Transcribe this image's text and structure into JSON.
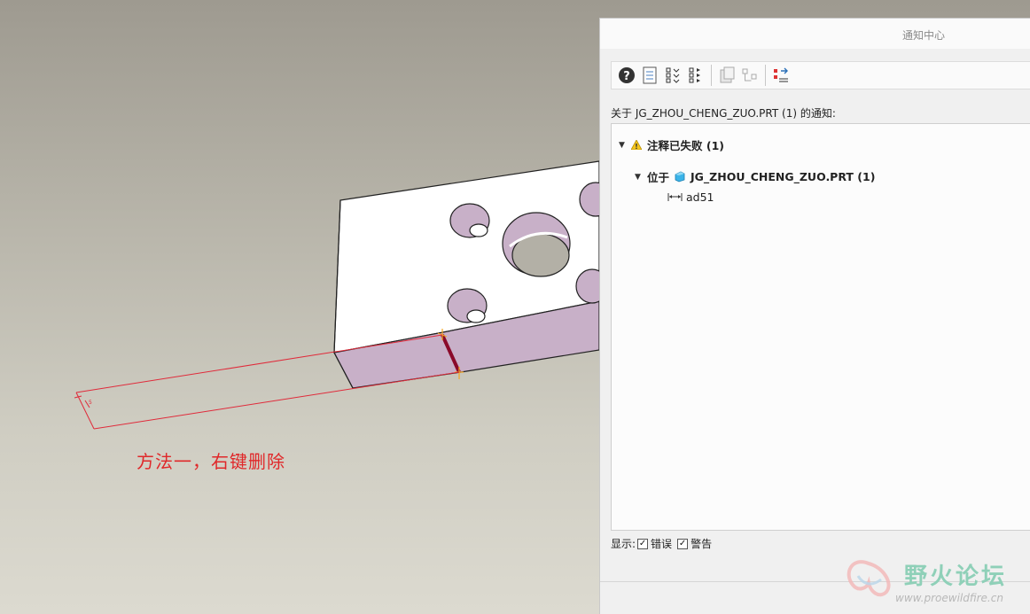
{
  "annotation_text": "方法一，右键删除",
  "dialog": {
    "title": "通知中心",
    "about_text": "关于 JG_ZHOU_CHENG_ZUO.PRT (1) 的通知:",
    "toolbar": {
      "icons": [
        "help-icon",
        "report-icon",
        "expand-all-icon",
        "collapse-all-icon",
        "copy-icon",
        "structure-icon",
        "filter-icon"
      ]
    },
    "tree": {
      "group_label": "注释已失败 (1)",
      "location_prefix": "位于",
      "location_label": "JG_ZHOU_CHENG_ZUO.PRT (1)",
      "item_label": "ad51"
    },
    "footer": {
      "display_label": "显示:",
      "errors_label": "错误",
      "warnings_label": "警告",
      "errors_checked": true,
      "warnings_checked": true
    }
  },
  "watermark": {
    "title": "野火论坛",
    "url": "www.proewildfire.cn"
  },
  "colors": {
    "annotation_red": "#e0282a",
    "model_face_side": "#c8b0c8",
    "model_face_top": "#ffffff",
    "highlight_edge": "#8a0a2a",
    "warning_yellow": "#f5c518",
    "part_blue": "#3ab3e8"
  }
}
